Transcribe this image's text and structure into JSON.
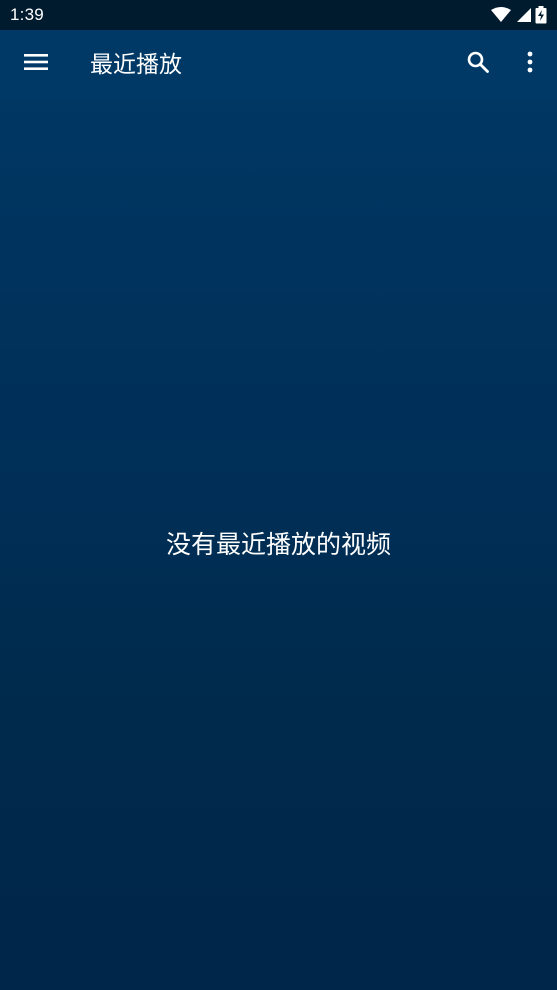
{
  "status_bar": {
    "time": "1:39",
    "icons": [
      "wifi-icon",
      "signal-icon",
      "battery-charging-icon"
    ]
  },
  "app_bar": {
    "title": "最近播放",
    "icons": [
      "menu-icon",
      "search-icon",
      "more-vert-icon"
    ]
  },
  "main": {
    "empty_message": "没有最近播放的视频"
  },
  "colors": {
    "status_bar_bg": "#001a2e",
    "app_bar_bg": "#003866",
    "content_bg": "#002f58",
    "text": "#ffffff"
  }
}
